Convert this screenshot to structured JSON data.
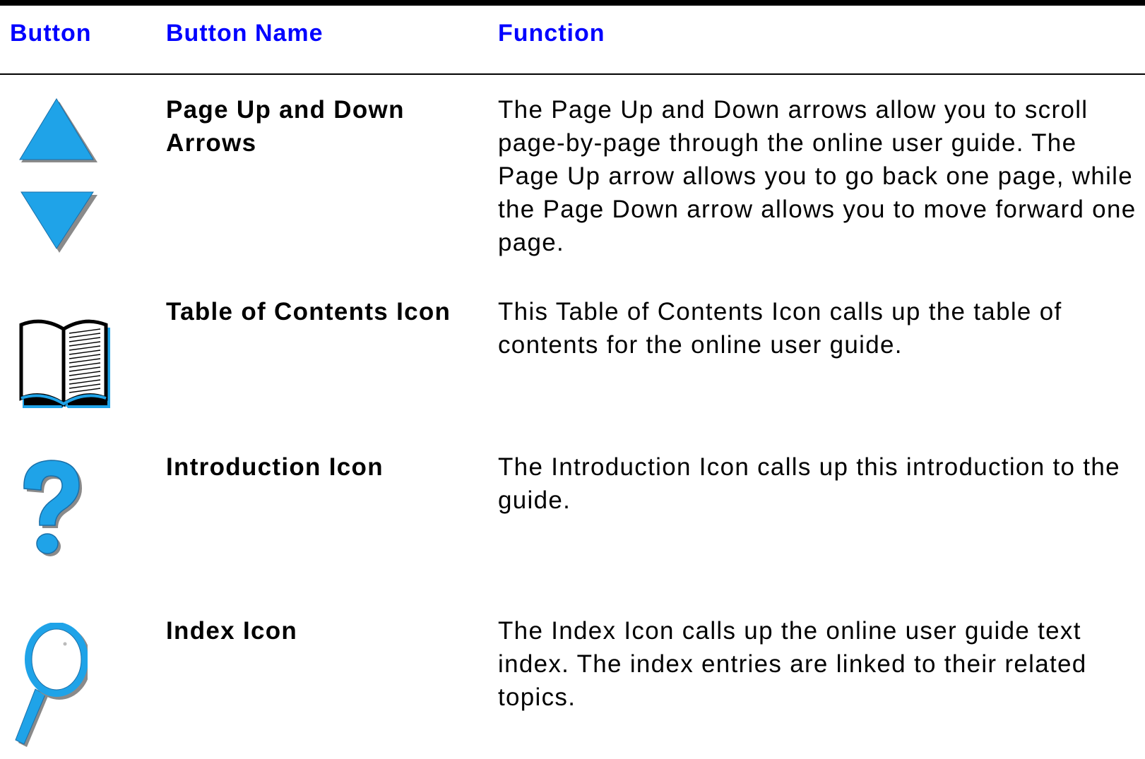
{
  "header": {
    "button": "Button",
    "button_name": "Button Name",
    "function": "Function"
  },
  "rows": [
    {
      "icon": "page-up-down-arrows-icon",
      "name": "Page Up and Down Arrows",
      "function": "The Page Up and Down arrows allow you to scroll page-by-page through the online user guide. The Page Up arrow allows you to go back one page, while the Page Down arrow allows you to move forward one page."
    },
    {
      "icon": "book-icon",
      "name": "Table of Contents Icon",
      "function": "This Table of Contents Icon calls up the table of contents for the online user guide."
    },
    {
      "icon": "question-mark-icon",
      "name": "Introduction Icon",
      "function": "The Introduction Icon calls up this introduction to the guide."
    },
    {
      "icon": "magnifying-glass-icon",
      "name": "Index Icon",
      "function": "The Index Icon calls up the online user guide text index. The index entries are linked to their related topics."
    }
  ],
  "colors": {
    "header_text": "#0000ff",
    "icon_fill": "#1fa3e8",
    "icon_shadow": "#8a8a8a"
  }
}
